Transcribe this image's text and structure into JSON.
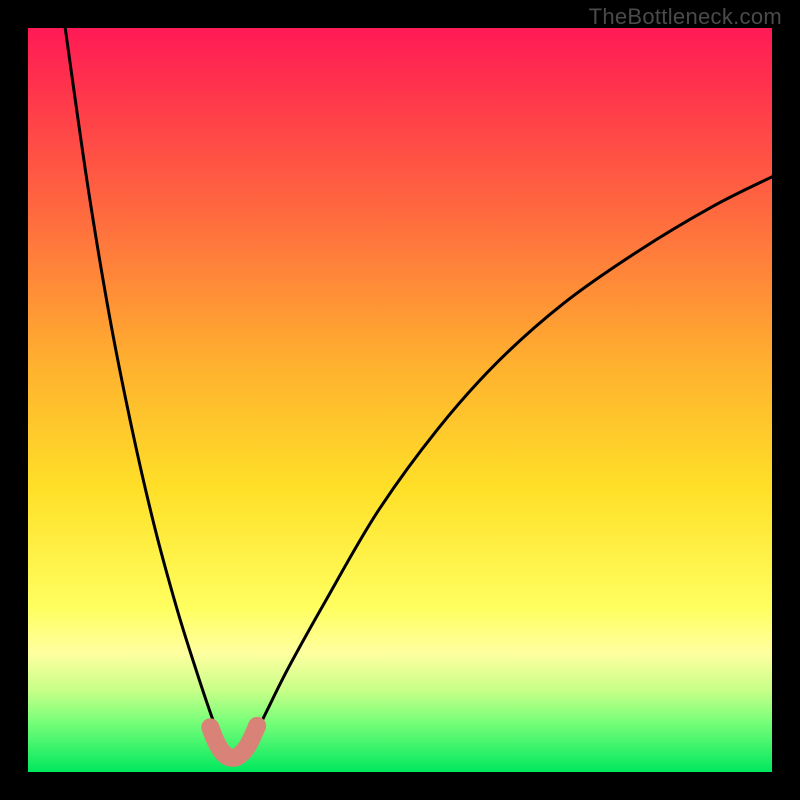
{
  "watermark": "TheBottleneck.com",
  "chart_data": {
    "type": "line",
    "title": "",
    "xlabel": "",
    "ylabel": "",
    "xlim": [
      0,
      100
    ],
    "ylim": [
      0,
      100
    ],
    "series": [
      {
        "name": "bottleneck-curve",
        "x": [
          5,
          8,
          11,
          14,
          17,
          20,
          22.5,
          24.5,
          26,
          27,
          28,
          30,
          32,
          35,
          40,
          47,
          55,
          63,
          72,
          82,
          92,
          100
        ],
        "values": [
          100,
          79,
          61,
          46,
          33,
          22,
          14,
          8,
          4,
          2,
          2,
          4,
          8,
          14,
          23,
          35,
          46,
          55,
          63,
          70,
          76,
          80
        ]
      }
    ],
    "markers": {
      "name": "bottom-highlight",
      "color": "#d98378",
      "points_x": [
        24.5,
        25.3,
        26.2,
        27.0,
        28.0,
        29.0,
        29.8,
        30.8
      ],
      "points_y": [
        6.0,
        4.0,
        2.6,
        2.0,
        2.0,
        2.8,
        4.0,
        6.2
      ]
    }
  }
}
